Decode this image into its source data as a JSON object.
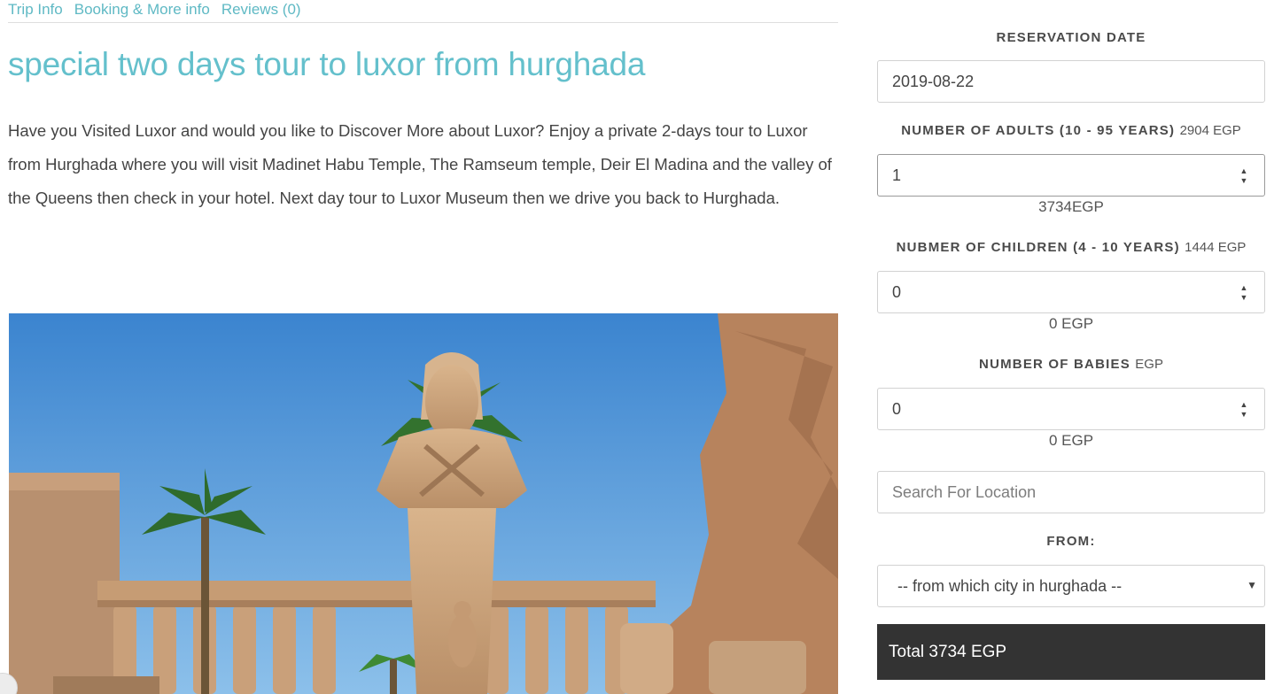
{
  "tabs": [
    "Trip Info",
    "Booking & More info",
    "Reviews (0)"
  ],
  "trip": {
    "title": "special two days tour to luxor from hurghada",
    "description": "Have you Visited Luxor and would you like to Discover More about Luxor? Enjoy a private 2-days tour to Luxor from Hurghada where you will visit Madinet Habu Temple, The Ramseum temple, Deir El Madina and the valley of the Queens then check in your hotel. Next day tour to Luxor Museum then we drive you back to Hurghada."
  },
  "booking": {
    "reservation_label": "RESERVATION DATE",
    "reservation_value": "2019-08-22",
    "adults_label": "NUMBER OF ADULTS (10 - 95 YEARS)",
    "adults_price": "2904 EGP",
    "adults_value": "1",
    "adults_subtotal": "3734EGP",
    "children_label": "NUBMER OF CHILDREN (4 - 10 YEARS)",
    "children_price": "1444 EGP",
    "children_value": "0",
    "children_subtotal": "0 EGP",
    "babies_label": "NUMBER OF BABIES",
    "babies_price": "EGP",
    "babies_value": "0",
    "babies_subtotal": "0 EGP",
    "location_placeholder": "Search For Location",
    "from_label": "FROM:",
    "from_selected": "-- from which city in hurghada --",
    "total": "Total 3734 EGP"
  },
  "icons": {
    "spin": "up-down-arrows-icon",
    "select": "chevron-down-icon"
  }
}
